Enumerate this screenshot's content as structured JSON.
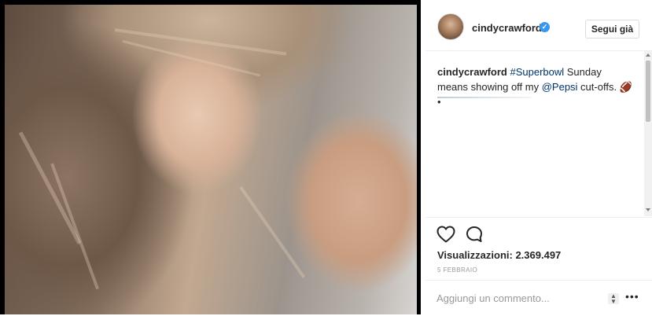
{
  "post": {
    "username": "cindycrawford",
    "verified": true,
    "follow_label": "Segui già",
    "caption": {
      "user": "cindycrawford",
      "hashtag": "#Superbowl",
      "text1": " Sunday means showing off my ",
      "mention": "@Pepsi",
      "text2": " cut-offs. ",
      "emoji": "🏈•"
    },
    "views": "Visualizzazioni: 2.369.497",
    "date": "5 FEBBRAIO",
    "comment_placeholder": "Aggiungi un commento...",
    "more_glyph": "•••"
  },
  "icons": {
    "like": "heart-icon",
    "comment": "speech-bubble-icon",
    "verified": "verified-badge-icon",
    "sort": "sort-arrows-icon",
    "more": "more-options-icon"
  },
  "colors": {
    "link": "#003569",
    "verified": "#3897f0",
    "border": "#efefef",
    "muted": "#999999"
  }
}
